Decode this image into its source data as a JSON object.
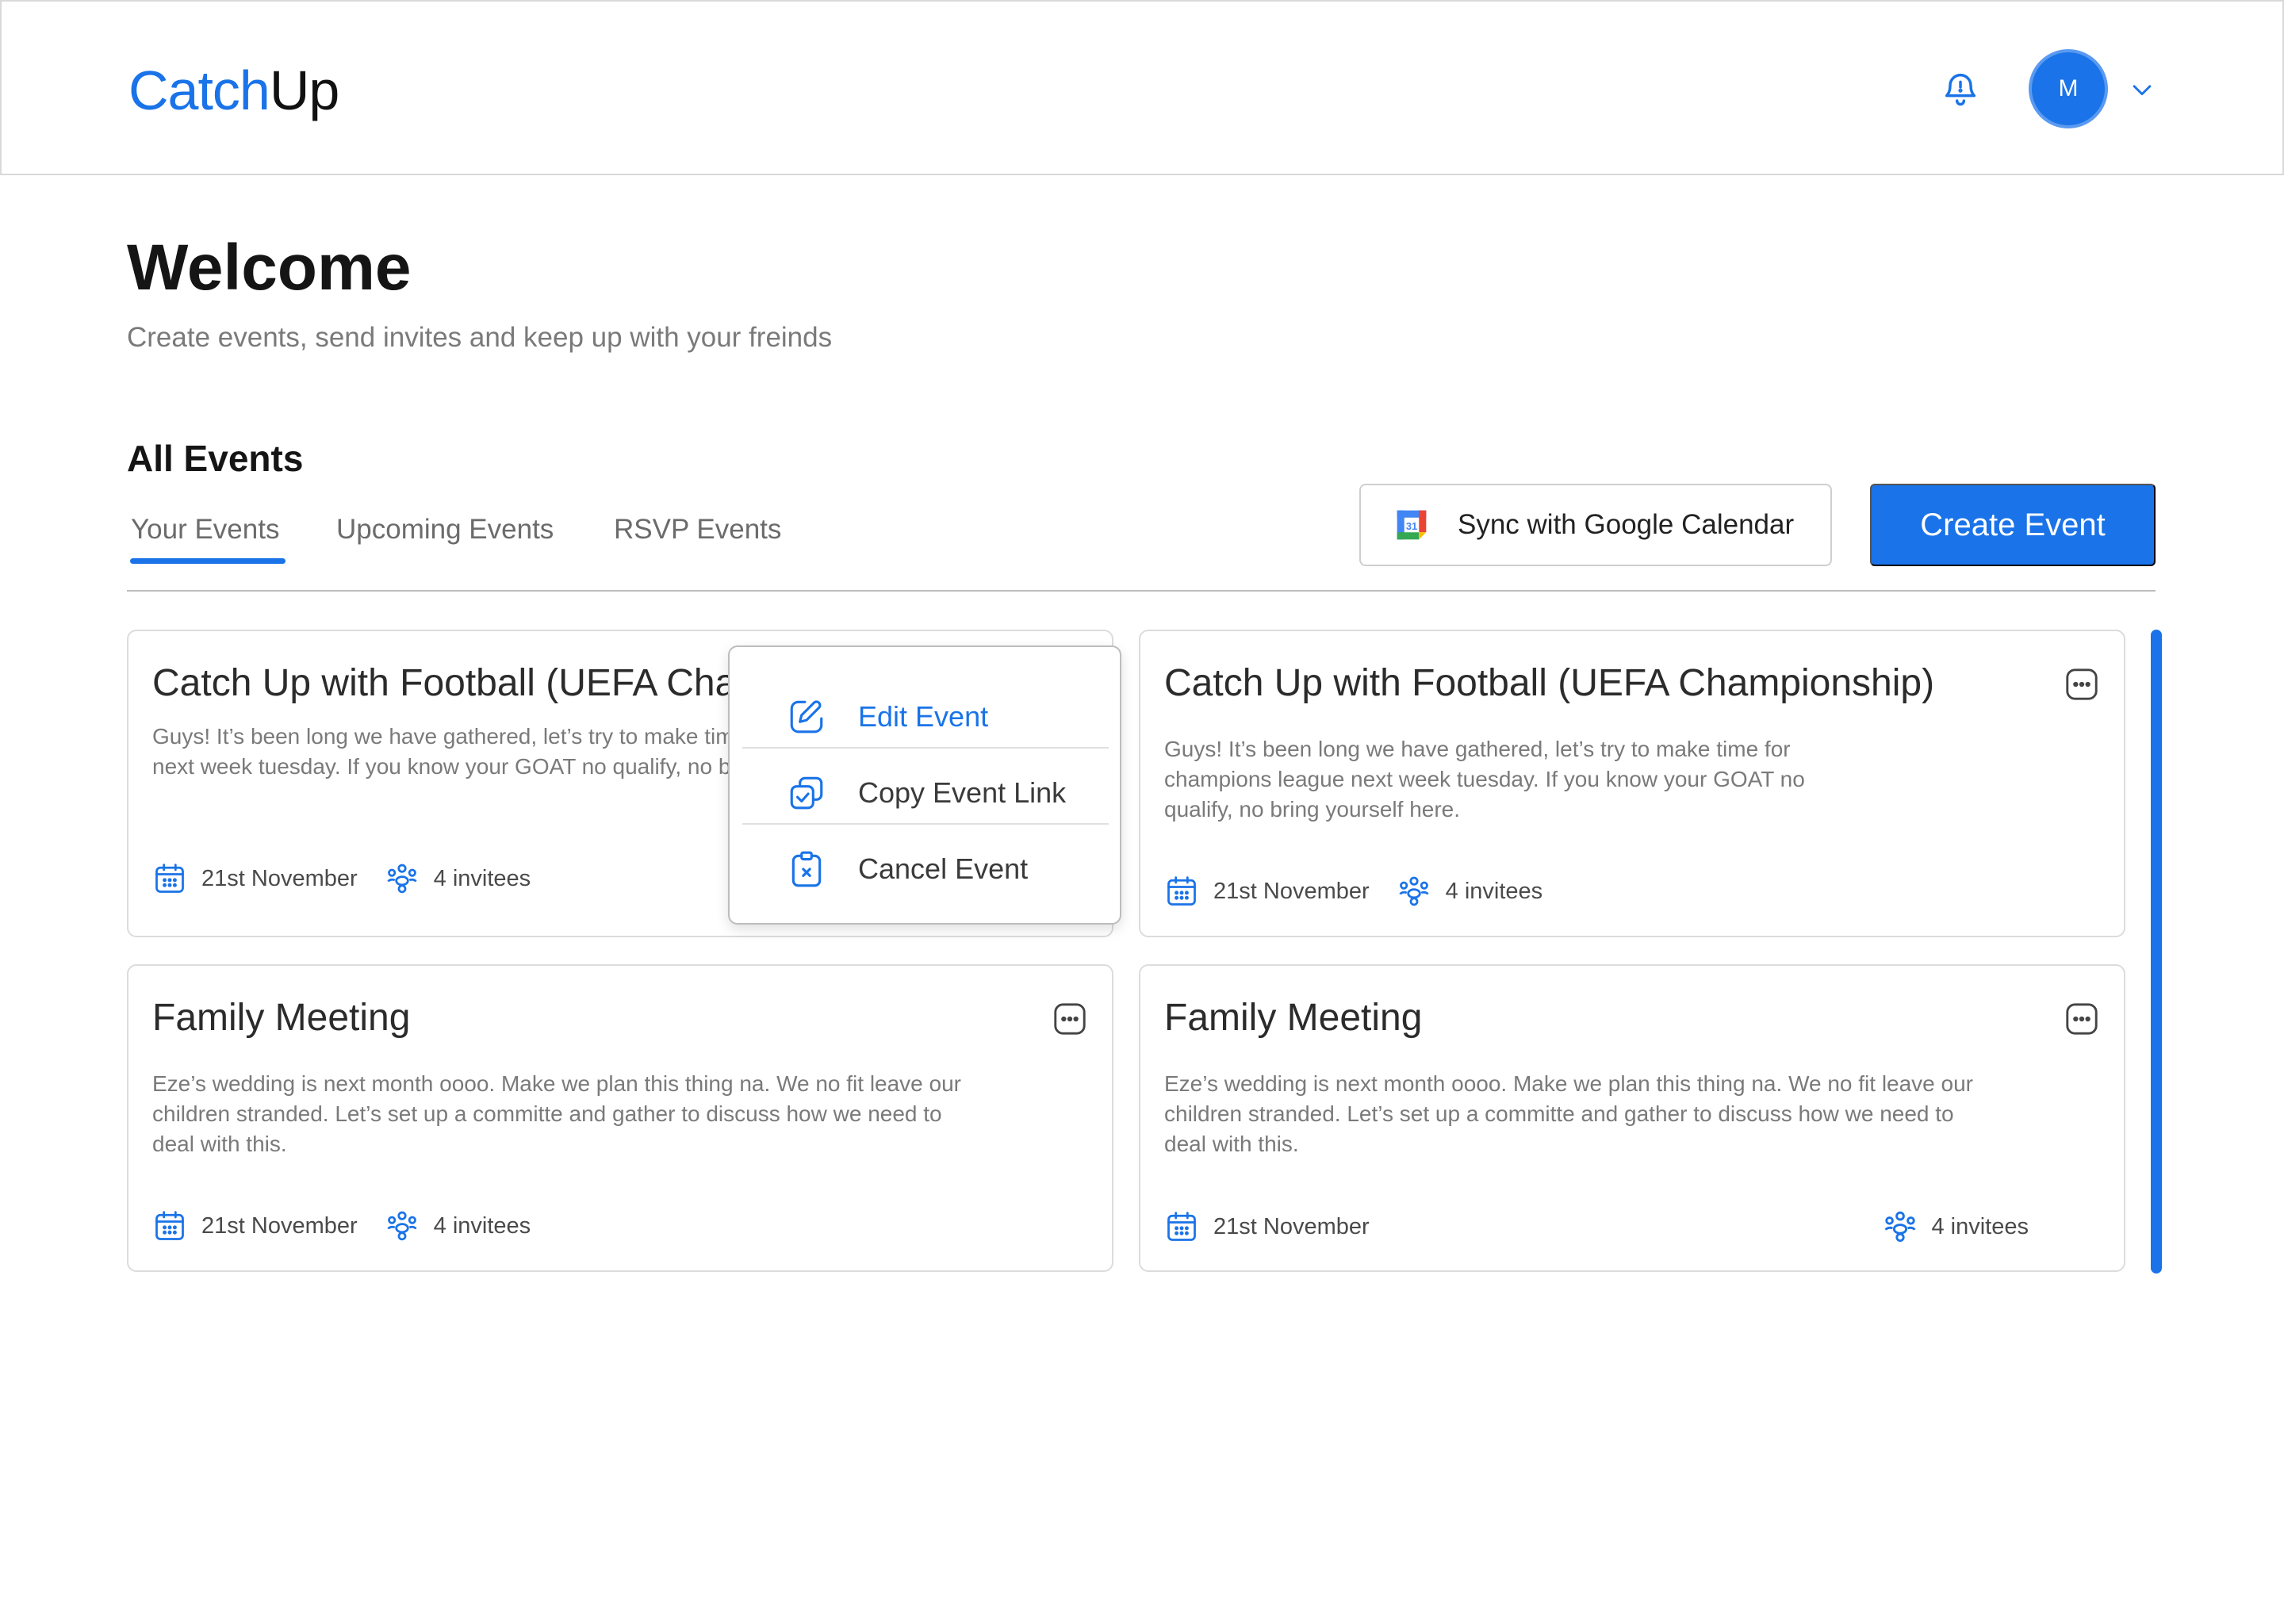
{
  "header": {
    "logo_part1": "Catch",
    "logo_part2": "Up",
    "avatar_initial": "M"
  },
  "welcome": {
    "title": "Welcome",
    "subtitle": "Create events, send invites and keep up with your freinds"
  },
  "events_section": {
    "title": "All Events",
    "tabs": [
      {
        "label": "Your Events",
        "active": true
      },
      {
        "label": "Upcoming Events",
        "active": false
      },
      {
        "label": "RSVP Events",
        "active": false
      }
    ],
    "sync_button": "Sync with Google Calendar",
    "create_button": "Create Event"
  },
  "cards": [
    {
      "title": "Catch Up with Football (UEFA Championship)",
      "description": "Guys! It’s been long we have gathered, let’s try to make time for champions league next week tuesday. If you know your GOAT no qualify, no bring yourself here.",
      "date": "21st November",
      "invitees": "4 invitees"
    },
    {
      "title": "Catch Up with Football (UEFA Championship)",
      "description": "Guys! It’s been long we have gathered, let’s try to make time for champions league next week tuesday. If you know your GOAT no qualify, no bring yourself here.",
      "date": "21st November",
      "invitees": "4 invitees"
    },
    {
      "title": "Family Meeting",
      "description": "Eze’s wedding is next month oooo. Make we plan this thing na. We no fit leave our children stranded. Let’s set up a committe and gather to discuss how we need to deal with this.",
      "date": "21st November",
      "invitees": "4 invitees"
    },
    {
      "title": "Family Meeting",
      "description": "Eze’s wedding is next month oooo. Make we plan this thing na. We no fit leave our children stranded. Let’s set up a committe and gather to discuss how we need to deal with this.",
      "date": "21st November",
      "invitees": "4 invitees"
    }
  ],
  "context_menu": {
    "items": [
      {
        "label": "Edit Event",
        "icon": "edit-icon"
      },
      {
        "label": "Copy Event Link",
        "icon": "copy-link-icon"
      },
      {
        "label": "Cancel Event",
        "icon": "cancel-icon"
      }
    ]
  },
  "colors": {
    "accent": "#1a73e8",
    "text_primary": "#151515",
    "text_muted": "#7a7a7a",
    "border": "#dcdcdc"
  }
}
